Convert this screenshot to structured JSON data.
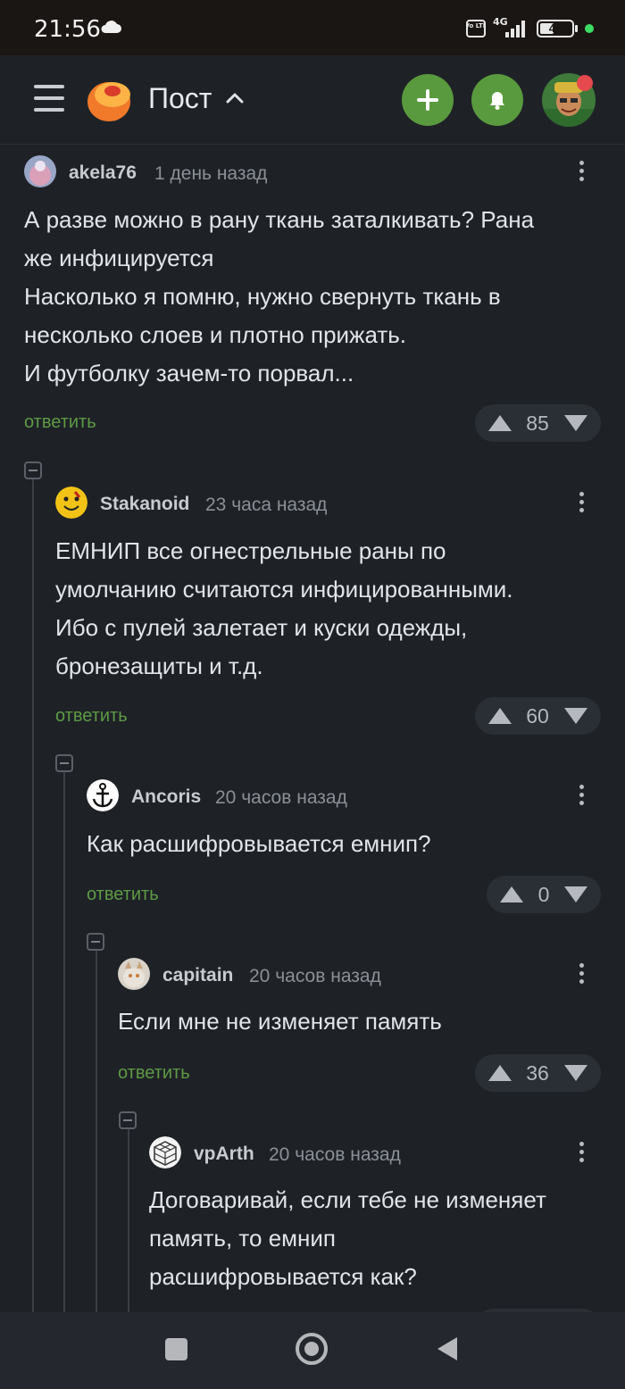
{
  "status_bar": {
    "time": "21:56",
    "volte_label": "Vo LTE",
    "network_label": "4G",
    "battery": "43",
    "battery_level": 0.43,
    "icons": [
      "cloud-icon",
      "volte-icon",
      "signal-icon",
      "battery-icon"
    ]
  },
  "header": {
    "title": "Пост",
    "icons": [
      "menu-icon",
      "pikabu-logo",
      "chevron-up-icon",
      "plus-icon",
      "bell-icon",
      "avatar"
    ],
    "accent": "#5a9a3e"
  },
  "comments": [
    {
      "author": "akela76",
      "time": "1 день назад",
      "lines": [
        "А разве можно в рану ткань заталкивать? Рана",
        "же инфицируется",
        "Насколько я помню, нужно свернуть ткань в",
        "несколько слоев и плотно прижать.",
        "И футболку зачем-то порвал..."
      ],
      "reply": "ответить",
      "score": "85"
    },
    {
      "author": "Stakanoid",
      "time": "23 часа назад",
      "lines": [
        "ЕМНИП все огнестрельные раны по",
        "умолчанию считаются инфицированными.",
        "Ибо с пулей залетает и куски одежды,",
        "бронезащиты и т.д."
      ],
      "reply": "ответить",
      "score": "60"
    },
    {
      "author": "Ancoris",
      "time": "20 часов назад",
      "lines": [
        "Как расшифровывается емнип?"
      ],
      "reply": "ответить",
      "score": "0"
    },
    {
      "author": "capitain",
      "time": "20 часов назад",
      "lines": [
        "Если мне не изменяет память"
      ],
      "reply": "ответить",
      "score": "36"
    },
    {
      "author": "vpArth",
      "time": "20 часов назад",
      "lines": [
        "Договаривай, если тебе не изменяет",
        "память, то емнип",
        "расшифровывается как?"
      ]
    }
  ],
  "colors": {
    "background": "#1e2227",
    "reply_link": "#5e9a44",
    "vote_pill": "#2a2f36"
  }
}
